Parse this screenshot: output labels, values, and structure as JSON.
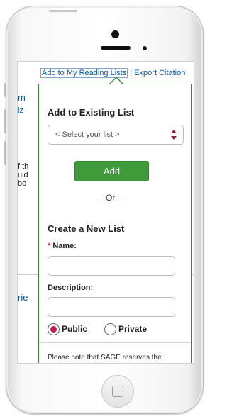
{
  "top_links": {
    "reading_lists": "Add to My Reading Lists",
    "separator": "|",
    "export": "Export Citation"
  },
  "background": {
    "fragment_1": "m",
    "fragment_2": "iz",
    "fragment_3": "f th",
    "fragment_4": "uid",
    "fragment_5": "bo",
    "fragment_6": "rie"
  },
  "popup": {
    "existing_title": "Add to Existing List",
    "select_placeholder": "< Select your list >",
    "add_button": "Add",
    "or_label": "Or",
    "new_title": "Create a New List",
    "required_mark": "*",
    "name_label": "Name:",
    "description_label": "Description:",
    "public_label": "Public",
    "private_label": "Private",
    "visibility_selected": "Public",
    "note": "Please note that SAGE reserves the"
  },
  "colors": {
    "accent_green": "#3f9a3a",
    "link_blue": "#0b58a4",
    "radio_selected": "#c9184a"
  },
  "icons": {
    "select_arrow": "updown-chevron-icon",
    "home": "home-button-icon"
  }
}
